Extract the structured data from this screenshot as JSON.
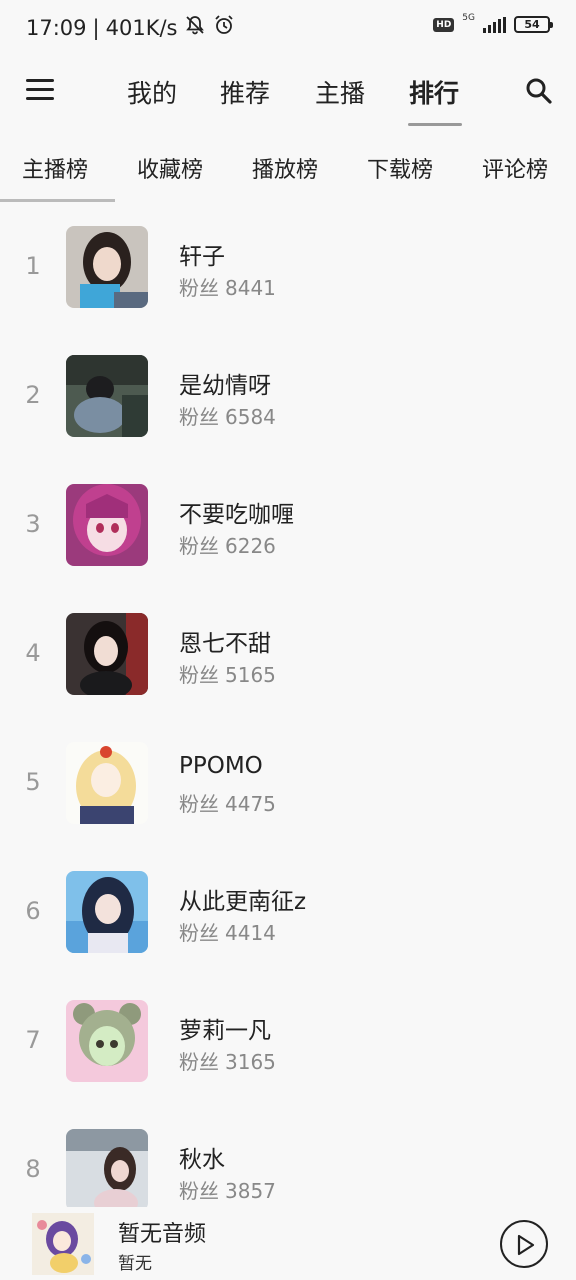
{
  "status": {
    "time": "17:09",
    "speed": "401K/s",
    "hd": "HD",
    "network": "5G",
    "battery": "54",
    "icons": [
      "mute-bell-icon",
      "alarm-icon",
      "signal-icon",
      "battery-icon"
    ]
  },
  "nav": {
    "menu_icon": "hamburger-menu-icon",
    "tabs": [
      {
        "label": "我的"
      },
      {
        "label": "推荐"
      },
      {
        "label": "主播"
      },
      {
        "label": "排行"
      }
    ],
    "active_tab": "排行",
    "search_icon": "search-icon"
  },
  "sub_tabs": {
    "items": [
      {
        "label": "主播榜"
      },
      {
        "label": "收藏榜"
      },
      {
        "label": "播放榜"
      },
      {
        "label": "下载榜"
      },
      {
        "label": "评论榜"
      }
    ],
    "active": "主播榜"
  },
  "fans_label": "粉丝",
  "ranking": [
    {
      "rank": "1",
      "name": "轩子",
      "fans": "8441"
    },
    {
      "rank": "2",
      "name": "是幼情呀",
      "fans": "6584"
    },
    {
      "rank": "3",
      "name": "不要吃咖喱",
      "fans": "6226"
    },
    {
      "rank": "4",
      "name": "恩七不甜",
      "fans": "5165"
    },
    {
      "rank": "5",
      "name": "PPOMO",
      "fans": "4475"
    },
    {
      "rank": "6",
      "name": "从此更南征z",
      "fans": "4414"
    },
    {
      "rank": "7",
      "name": "萝莉一凡",
      "fans": "3165"
    },
    {
      "rank": "8",
      "name": "秋水",
      "fans": "3857"
    }
  ],
  "player": {
    "title": "暂无音频",
    "subtitle": "暂无",
    "play_icon": "play-icon"
  },
  "colors": {
    "background": "#f8f8f8",
    "text": "#222222",
    "muted": "#888888",
    "rank": "#999999"
  }
}
